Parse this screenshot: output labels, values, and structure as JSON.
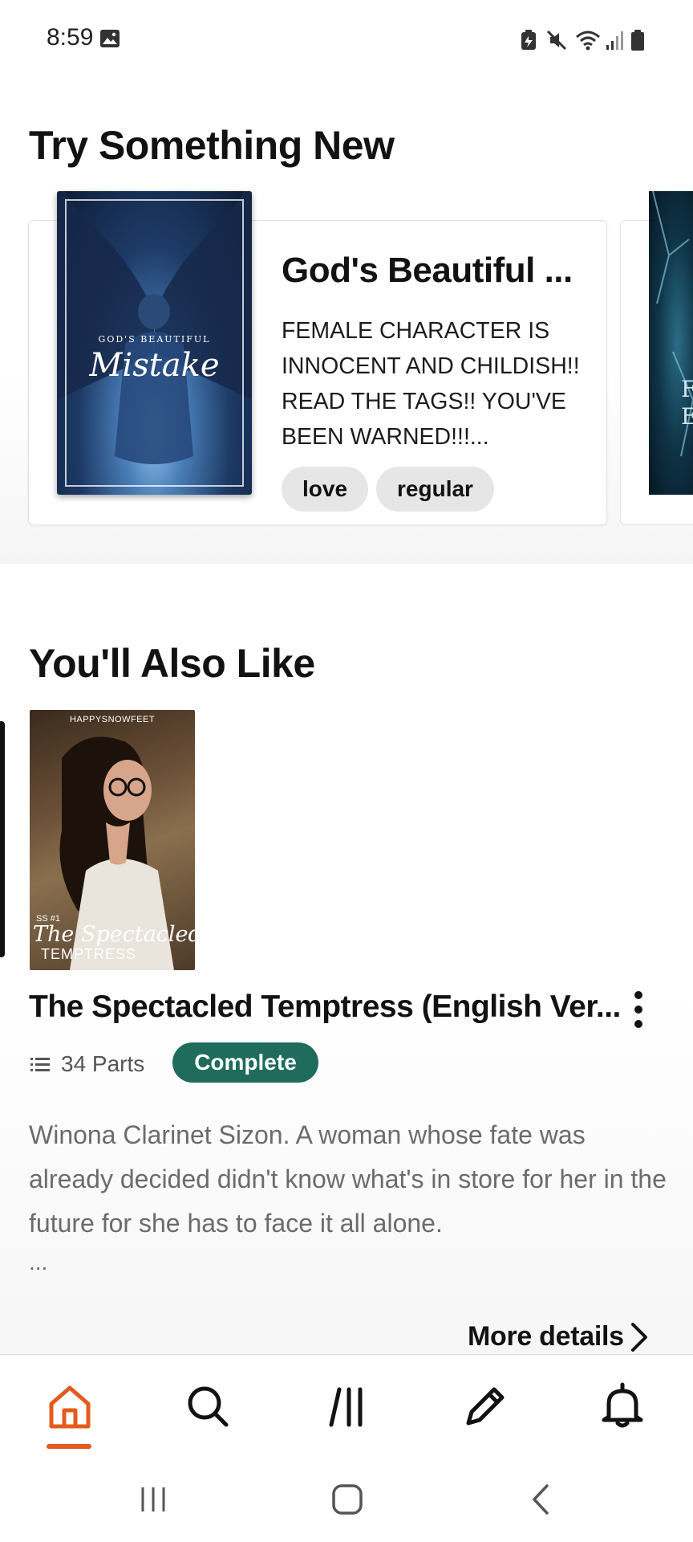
{
  "status_bar": {
    "time": "8:59",
    "icons": [
      "image-icon",
      "battery-saver-icon",
      "mute-icon",
      "wifi-icon",
      "signal-icon",
      "battery-icon"
    ]
  },
  "try_something_new": {
    "heading": "Try Something New",
    "card": {
      "title": "God's Beautiful ...",
      "description": "FEMALE CHARACTER IS INNOCENT AND CHILDISH!! READ THE TAGS!! YOU'VE BEEN WARNED!!!...",
      "cover_text_top": "GOD'S BEAUTIFUL",
      "cover_text_main": "Mistake",
      "tags": [
        "love",
        "regular"
      ]
    },
    "next_card_cover_letters": "F\nE"
  },
  "youll_also_like": {
    "heading": "You'll Also Like",
    "book": {
      "cover_author": "HAPPYSNOWFEET",
      "cover_series": "SS #1",
      "cover_title_line1": "The Spectacled",
      "cover_title_line2": "TEMPTRESS",
      "title": "The Spectacled Temptress (English Ver...",
      "parts": "34 Parts",
      "status": "Complete",
      "description": "Winona Clarinet Sizon. A woman whose fate was already decided didn't know what's in store  for her in the future for she has to face it all alone.",
      "ellipsis": "...",
      "more_details": "More details"
    }
  },
  "bottom_nav": {
    "items": [
      "home-icon",
      "search-icon",
      "library-icon",
      "write-icon",
      "notifications-icon"
    ],
    "active": "home-icon",
    "accent_color": "#e35b1e"
  },
  "system_nav": {
    "items": [
      "recents-button",
      "home-button",
      "back-button"
    ]
  },
  "colors": {
    "complete_badge": "#1f6b5c",
    "tag_bg": "#e6e6e6",
    "description_text": "#6b6b6b"
  }
}
